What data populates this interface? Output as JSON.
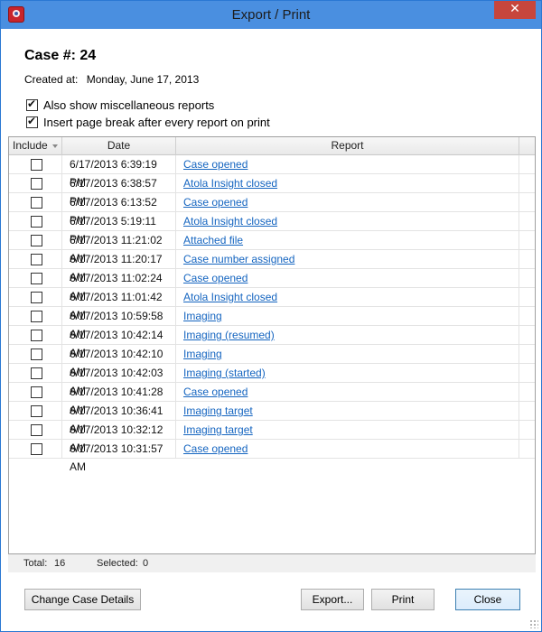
{
  "window": {
    "title": "Export / Print",
    "close_glyph": "✕"
  },
  "case": {
    "title": "Case #: 24",
    "created_label": "Created at:",
    "created_value": "Monday, June 17, 2013"
  },
  "options": [
    {
      "label": "Also show miscellaneous reports",
      "checked": true
    },
    {
      "label": "Insert page break after every report on print",
      "checked": true
    }
  ],
  "table": {
    "columns": {
      "include": "Include",
      "date": "Date",
      "report": "Report"
    },
    "rows": [
      {
        "date": "6/17/2013 6:39:19 PM",
        "report": "Case opened",
        "included": false
      },
      {
        "date": "6/17/2013 6:38:57 PM",
        "report": "Atola Insight closed",
        "included": false
      },
      {
        "date": "6/17/2013 6:13:52 PM",
        "report": "Case opened",
        "included": false
      },
      {
        "date": "6/17/2013 5:19:11 PM",
        "report": "Atola Insight closed",
        "included": false
      },
      {
        "date": "6/17/2013 11:21:02 AM",
        "report": "Attached file",
        "included": false
      },
      {
        "date": "6/17/2013 11:20:17 AM",
        "report": "Case number assigned",
        "included": false
      },
      {
        "date": "6/17/2013 11:02:24 AM",
        "report": "Case opened",
        "included": false
      },
      {
        "date": "6/17/2013 11:01:42 AM",
        "report": "Atola Insight closed",
        "included": false
      },
      {
        "date": "6/17/2013 10:59:58 AM",
        "report": "Imaging",
        "included": false
      },
      {
        "date": "6/17/2013 10:42:14 AM",
        "report": "Imaging (resumed)",
        "included": false
      },
      {
        "date": "6/17/2013 10:42:10 AM",
        "report": "Imaging",
        "included": false
      },
      {
        "date": "6/17/2013 10:42:03 AM",
        "report": "Imaging (started)",
        "included": false
      },
      {
        "date": "6/17/2013 10:41:28 AM",
        "report": "Case opened",
        "included": false
      },
      {
        "date": "6/17/2013 10:36:41 AM",
        "report": "Imaging target",
        "included": false
      },
      {
        "date": "6/17/2013 10:32:12 AM",
        "report": "Imaging target",
        "included": false
      },
      {
        "date": "6/17/2013 10:31:57 AM",
        "report": "Case opened",
        "included": false
      }
    ]
  },
  "stats": {
    "total_label": "Total:",
    "total_value": "16",
    "selected_label": "Selected:",
    "selected_value": "0"
  },
  "buttons": {
    "change_case": "Change Case Details",
    "export": "Export...",
    "print": "Print",
    "close": "Close"
  },
  "colors": {
    "titlebar": "#4a8fe0",
    "link": "#1565c0",
    "close_button": "#c7463c"
  }
}
